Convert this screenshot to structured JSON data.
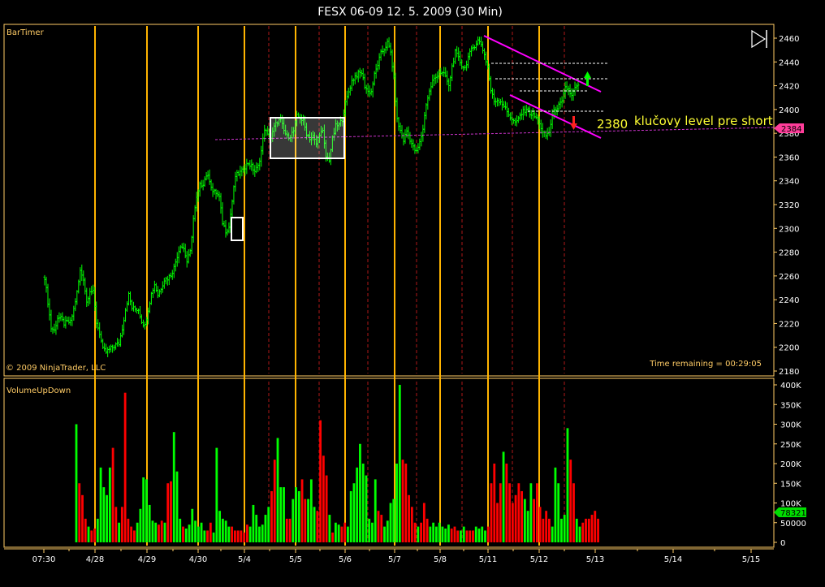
{
  "window": {
    "title": "FESX 06-09  12. 5. 2009 (30 Min)"
  },
  "price_panel": {
    "indicator_label": "BarTimer",
    "copyright": "© 2009 NinjaTrader, LLC",
    "time_remaining": "Time remaining = 00:29:05",
    "annotation_level": "2380",
    "annotation_text": "klučovy level pre short",
    "price_tag": "2384"
  },
  "volume_panel": {
    "label": "VolumeUpDown",
    "volume_tag": "78321"
  },
  "colors": {
    "background": "#000000",
    "axis": "#ffcc66",
    "up": "#00ff00",
    "down": "#ff0000",
    "session_line": "#ffb400",
    "midday_line": "#b01818",
    "trendline": "#ff00ff",
    "level_line": "#cc33cc",
    "annotation": "#ffff33"
  },
  "chart_data": [
    {
      "type": "ohlc",
      "title": "FESX 06-09  12. 5. 2009 (30 Min)",
      "instrument": "FESX 06-09",
      "interval": "30 Min",
      "ylim": [
        2180,
        2470
      ],
      "y_ticks": [
        2460,
        2440,
        2420,
        2400,
        2380,
        2360,
        2340,
        2320,
        2300,
        2280,
        2260,
        2240,
        2220,
        2200,
        2180
      ],
      "x_ticks": [
        "07:30",
        "4/28",
        "4/29",
        "4/30",
        "5/4",
        "5/5",
        "5/6",
        "5/7",
        "5/8",
        "5/11",
        "5/12",
        "5/13",
        "5/14",
        "5/15"
      ],
      "close_path": {
        "x": [
          0,
          2,
          4,
          6,
          8,
          10,
          12,
          14,
          16,
          18,
          20,
          22,
          24,
          26,
          28,
          30,
          32,
          34,
          36,
          38,
          40,
          42,
          44,
          46,
          48,
          50,
          52,
          54,
          56,
          58,
          60,
          62,
          64,
          66,
          68,
          70,
          72,
          74,
          76,
          78,
          80,
          82,
          84,
          86,
          88,
          90,
          92,
          94,
          96,
          98,
          100,
          102,
          104,
          106,
          108,
          110,
          112,
          114,
          116,
          118,
          120,
          122,
          124,
          126,
          128,
          130,
          132,
          134,
          136,
          138,
          140,
          142,
          144,
          146,
          148,
          150,
          152,
          154,
          156,
          158,
          160,
          162,
          164,
          166,
          168,
          170,
          172,
          174,
          176,
          178,
          180,
          182,
          184,
          186,
          188,
          190,
          192,
          194,
          196,
          198,
          200,
          202,
          204,
          206,
          208,
          210,
          212,
          214,
          216,
          218,
          220,
          222,
          224,
          226,
          228,
          230,
          232,
          234,
          236,
          238,
          240,
          242,
          244,
          246,
          248,
          250,
          252,
          254,
          256,
          258,
          260,
          262,
          264,
          266,
          268,
          270,
          272,
          274,
          276,
          278,
          280,
          282,
          284,
          286,
          288,
          290,
          292,
          294,
          296,
          298,
          300,
          302,
          304,
          306,
          308,
          310,
          312,
          314,
          316,
          318,
          320,
          322,
          324,
          326,
          328,
          330
        ],
        "close": [
          2259,
          2238,
          2216,
          2214,
          2225,
          2224,
          2220,
          2221,
          2221,
          2232,
          2246,
          2264,
          2258,
          2238,
          2248,
          2246,
          2221,
          2212,
          2198,
          2196,
          2198,
          2200,
          2202,
          2203,
          2216,
          2232,
          2244,
          2233,
          2232,
          2232,
          2222,
          2218,
          2232,
          2245,
          2253,
          2244,
          2250,
          2257,
          2258,
          2261,
          2267,
          2277,
          2286,
          2283,
          2272,
          2280,
          2308,
          2325,
          2336,
          2338,
          2345,
          2341,
          2331,
          2330,
          2326,
          2305,
          2298,
          2301,
          2323,
          2344,
          2346,
          2348,
          2352,
          2355,
          2352,
          2348,
          2352,
          2365,
          2384,
          2378,
          2376,
          2385,
          2390,
          2391,
          2382,
          2377,
          2378,
          2382,
          2394,
          2393,
          2390,
          2380,
          2376,
          2377,
          2371,
          2380,
          2381,
          2360,
          2358,
          2375,
          2386,
          2387,
          2392,
          2405,
          2415,
          2424,
          2428,
          2430,
          2431,
          2420,
          2415,
          2415,
          2429,
          2438,
          2447,
          2451,
          2456,
          2448,
          2426,
          2391,
          2382,
          2374,
          2382,
          2375,
          2368,
          2364,
          2372,
          2384,
          2405,
          2415,
          2424,
          2427,
          2432,
          2430,
          2428,
          2419,
          2436,
          2448,
          2443,
          2437,
          2435,
          2444,
          2450,
          2454,
          2458,
          2455,
          2446,
          2436,
          2416,
          2407,
          2408,
          2407,
          2403,
          2398,
          2394,
          2390,
          2389,
          2395,
          2398,
          2401,
          2397,
          2395,
          2393,
          2389,
          2380,
          2378,
          2381,
          2395,
          2401,
          2403,
          2406,
          2418,
          2417,
          2411,
          2418,
          2419,
          2417,
          2410,
          2405,
          2395
        ]
      },
      "last_price": 2384,
      "horizontal_level": {
        "label": "2380",
        "note": "klučovy level pre short"
      }
    },
    {
      "type": "bar",
      "title": "VolumeUpDown",
      "ylim": [
        0,
        420000
      ],
      "y_ticks": [
        "400K",
        "350K",
        "300K",
        "250K",
        "200K",
        "150K",
        "100K",
        "50000",
        "0"
      ],
      "y_tick_values": [
        400000,
        350000,
        300000,
        250000,
        200000,
        150000,
        100000,
        50000,
        0
      ],
      "series": [
        {
          "name": "Up volume",
          "color": "#00ff00"
        },
        {
          "name": "Down volume",
          "color": "#ff0000"
        }
      ],
      "volume_profile": {
        "x": [
          0,
          2,
          4,
          6,
          8,
          10,
          12,
          14,
          16,
          18,
          20,
          22,
          24,
          26,
          28,
          30,
          32,
          34,
          36,
          38,
          40,
          42,
          44,
          46,
          48,
          50,
          52,
          54,
          56,
          58,
          60,
          62,
          64,
          66,
          68,
          70,
          72,
          74,
          76,
          78,
          80,
          82,
          84,
          86,
          88,
          90,
          92,
          94,
          96,
          98,
          100,
          102,
          104,
          106,
          108,
          110,
          112,
          114,
          116,
          118,
          120,
          122,
          124,
          126,
          128,
          130,
          132,
          134,
          136,
          138,
          140,
          142,
          144,
          146,
          148,
          150,
          152,
          154,
          156,
          158,
          160,
          162,
          164,
          166,
          168,
          170,
          172,
          174,
          176,
          178,
          180,
          182,
          184,
          186,
          188,
          190,
          192,
          194,
          196,
          198,
          200,
          202,
          204,
          206,
          208,
          210,
          212,
          214,
          216,
          218,
          220,
          222,
          224,
          226,
          228,
          230,
          232,
          234,
          236,
          238,
          240,
          242,
          244,
          246,
          248,
          250,
          252,
          254,
          256,
          258,
          260,
          262,
          264,
          266,
          268,
          270,
          272,
          274,
          276,
          278,
          280,
          282,
          284,
          286,
          288,
          290,
          292,
          294,
          296,
          298,
          300,
          302,
          304,
          306,
          308,
          310,
          312,
          314,
          316,
          318,
          320,
          322,
          324,
          326,
          328,
          330
        ],
        "volume": [
          300000,
          150000,
          120000,
          60000,
          40000,
          30000,
          35000,
          60000,
          190000,
          140000,
          120000,
          190000,
          240000,
          90000,
          50000,
          90000,
          380000,
          60000,
          40000,
          30000,
          50000,
          85000,
          165000,
          160000,
          95000,
          55000,
          50000,
          45000,
          55000,
          50000,
          150000,
          155000,
          280000,
          180000,
          60000,
          40000,
          35000,
          45000,
          85000,
          55000,
          40000,
          50000,
          30000,
          30000,
          50000,
          25000,
          240000,
          80000,
          60000,
          55000,
          40000,
          40000,
          30000,
          30000,
          30000,
          25000,
          45000,
          40000,
          95000,
          70000,
          40000,
          45000,
          70000,
          90000,
          130000,
          210000,
          265000,
          140000,
          140000,
          60000,
          60000,
          110000,
          140000,
          130000,
          160000,
          110000,
          110000,
          160000,
          90000,
          80000,
          310000,
          220000,
          170000,
          70000,
          25000,
          50000,
          45000,
          40000,
          50000,
          40000,
          130000,
          150000,
          190000,
          250000,
          200000,
          170000,
          60000,
          50000,
          160000,
          80000,
          70000,
          40000,
          55000,
          100000,
          110000,
          200000,
          400000,
          210000,
          200000,
          120000,
          90000,
          50000,
          40000,
          50000,
          100000,
          60000,
          40000,
          50000,
          40000,
          50000,
          40000,
          35000,
          45000,
          35000,
          40000,
          30000,
          30000,
          40000,
          30000,
          30000,
          30000,
          40000,
          35000,
          40000,
          30000,
          40000,
          150000,
          200000,
          100000,
          150000,
          230000,
          200000,
          150000,
          100000,
          120000,
          150000,
          130000,
          110000,
          80000,
          150000,
          110000,
          150000,
          90000,
          60000,
          80000,
          60000,
          40000,
          190000,
          150000,
          60000,
          70000,
          290000,
          210000,
          150000,
          60000,
          40000,
          50000,
          60000,
          60000,
          70000,
          80000,
          60000
        ]
      }
    }
  ]
}
